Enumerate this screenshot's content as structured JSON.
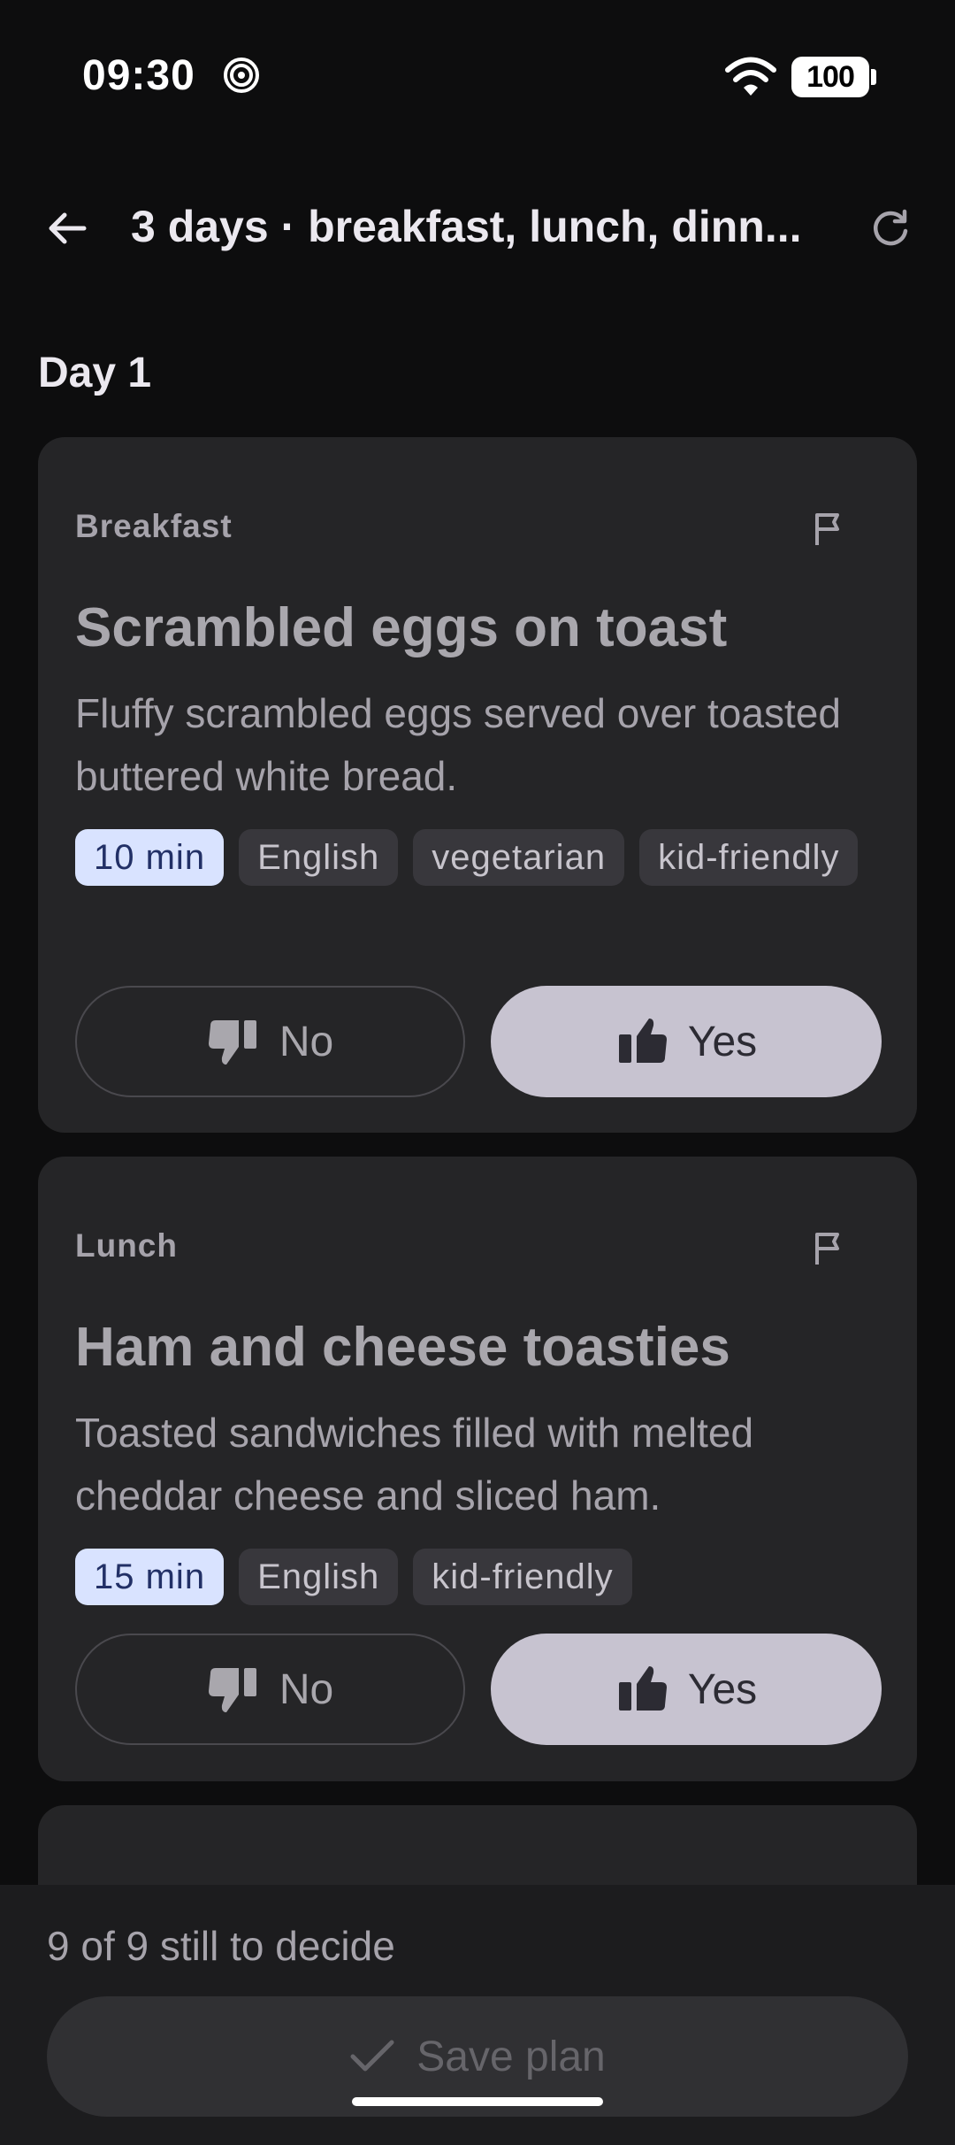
{
  "status_bar": {
    "time": "09:30",
    "battery": "100"
  },
  "app_bar": {
    "title": "3 days · breakfast, lunch, dinn..."
  },
  "day": {
    "heading": "Day 1"
  },
  "meals": [
    {
      "type": "Breakfast",
      "title": "Scrambled eggs on toast",
      "description": "Fluffy scrambled eggs served over toasted buttered white bread.",
      "time_chip": "10 min",
      "tags": [
        "English",
        "vegetarian",
        "kid-friendly"
      ],
      "no_label": "No",
      "yes_label": "Yes"
    },
    {
      "type": "Lunch",
      "title": "Ham and cheese toasties",
      "description": "Toasted sandwiches filled with melted cheddar cheese and sliced ham.",
      "time_chip": "15 min",
      "tags": [
        "English",
        "kid-friendly"
      ],
      "no_label": "No",
      "yes_label": "Yes"
    }
  ],
  "footer": {
    "remaining": "9 of 9 still to decide",
    "save_label": "Save plan"
  },
  "colors": {
    "background": "#0d0d0e",
    "card": "#252527",
    "time_chip": "#d9e3ff",
    "yes_button": "#c7c3d0"
  }
}
